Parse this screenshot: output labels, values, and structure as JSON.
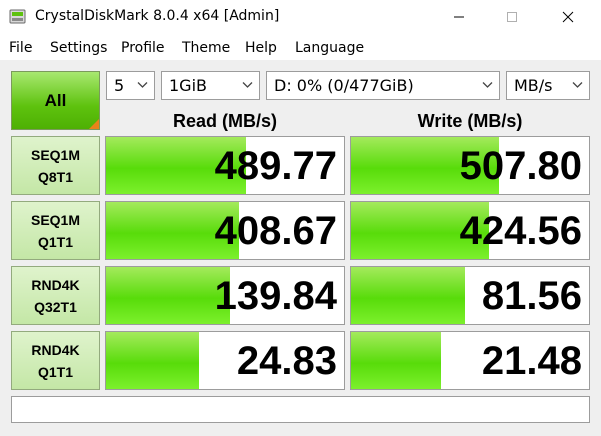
{
  "window": {
    "title": "CrystalDiskMark 8.0.4 x64 [Admin]"
  },
  "menu": [
    "File",
    "Settings",
    "Profile",
    "Theme",
    "Help",
    "Language"
  ],
  "controls": {
    "all_label": "All",
    "count": "5",
    "size": "1GiB",
    "drive": "D: 0% (0/477GiB)",
    "unit": "MB/s"
  },
  "headers": {
    "read": "Read (MB/s)",
    "write": "Write (MB/s)"
  },
  "tests": [
    {
      "line1": "SEQ1M",
      "line2": "Q8T1",
      "read": "489.77",
      "write": "507.80",
      "read_fill": 0.59,
      "write_fill": 0.62
    },
    {
      "line1": "SEQ1M",
      "line2": "Q1T1",
      "read": "408.67",
      "write": "424.56",
      "read_fill": 0.56,
      "write_fill": 0.58
    },
    {
      "line1": "RND4K",
      "line2": "Q32T1",
      "read": "139.84",
      "write": "81.56",
      "read_fill": 0.52,
      "write_fill": 0.48
    },
    {
      "line1": "RND4K",
      "line2": "Q1T1",
      "read": "24.83",
      "write": "21.48",
      "read_fill": 0.39,
      "write_fill": 0.38
    }
  ],
  "status": "",
  "colors": {
    "bar_green": "#58dc0a",
    "all_button": "#5ec20e",
    "label_bg": "#c4e7a6",
    "accent_orange": "#e8831a"
  }
}
